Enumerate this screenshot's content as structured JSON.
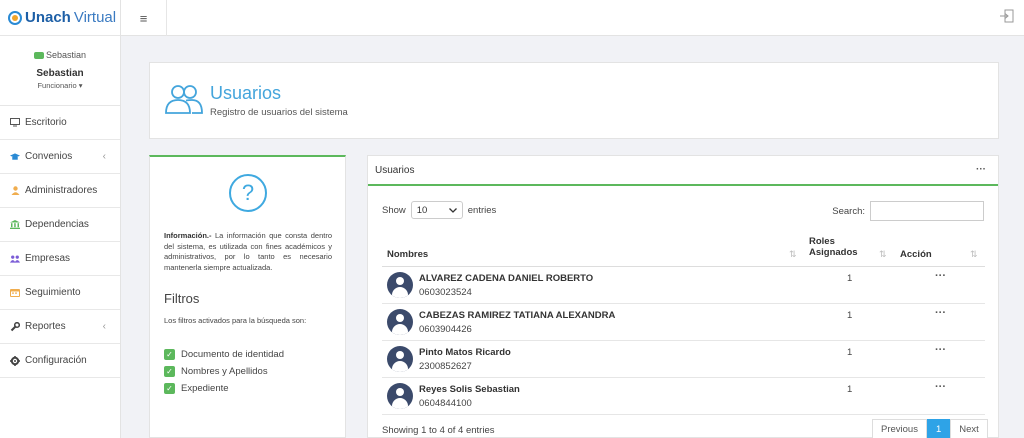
{
  "app": {
    "logo_bold": "Unach",
    "logo_light": "Virtual"
  },
  "profile": {
    "image_alt": "Sebastian",
    "name": "Sebastian",
    "role": "Funcionario ▾"
  },
  "sidebar": {
    "items": [
      {
        "label": "Escritorio",
        "icon": "desktop-icon",
        "color": "#555555"
      },
      {
        "label": "Convenios",
        "icon": "graduation-cap-icon",
        "color": "#2a8ad4",
        "chevron": "‹"
      },
      {
        "label": "Administradores",
        "icon": "user-icon",
        "color": "#f0ad4e"
      },
      {
        "label": "Dependencias",
        "icon": "bank-icon",
        "color": "#5cb85c"
      },
      {
        "label": "Empresas",
        "icon": "users-icon",
        "color": "#7b5cd6"
      },
      {
        "label": "Seguimiento",
        "icon": "calendar-icon",
        "color": "#f0ad4e"
      },
      {
        "label": "Reportes",
        "icon": "wrench-icon",
        "color": "#444444",
        "chevron": "‹"
      },
      {
        "label": "Configuración",
        "icon": "gear-icon",
        "color": "#444444"
      }
    ]
  },
  "header": {
    "title": "Usuarios",
    "subtitle": "Registro de usuarios del sistema"
  },
  "info": {
    "label": "Información.-",
    "text": " La información que consta dentro del sistema, es utilizada con fines académicos y administrativos, por lo tanto es necesario mantenerla siempre actualizada.",
    "filters_title": "Filtros",
    "filters_sub": "Los filtros activados para la búsqueda son:",
    "filters": [
      "Documento de identidad",
      "Nombres y Apellidos",
      "Expediente"
    ]
  },
  "table": {
    "card_title": "Usuarios",
    "menu": "···",
    "show_label": "Show",
    "entries_value": "10",
    "entries_label": "entries",
    "search_label": "Search:",
    "search_value": "",
    "columns": {
      "name": "Nombres",
      "roles_1": "Roles",
      "roles_2": "Asignados",
      "action": "Acción"
    },
    "rows": [
      {
        "name": "ALVAREZ CADENA DANIEL ROBERTO",
        "doc": "0603023524",
        "roles": "1",
        "action": "···"
      },
      {
        "name": "CABEZAS RAMIREZ TATIANA ALEXANDRA",
        "doc": "0603904426",
        "roles": "1",
        "action": "···"
      },
      {
        "name": "Pinto Matos Ricardo",
        "doc": "2300852627",
        "roles": "1",
        "action": "···"
      },
      {
        "name": "Reyes Solis Sebastian",
        "doc": "0604844100",
        "roles": "1",
        "action": "···"
      }
    ],
    "info": "Showing 1 to 4 of 4 entries",
    "pagination": {
      "previous": "Previous",
      "page": "1",
      "next": "Next"
    }
  },
  "colors": {
    "accent": "#44a5dc",
    "green": "#5cb85c",
    "page_active": "#2ea3e7"
  }
}
